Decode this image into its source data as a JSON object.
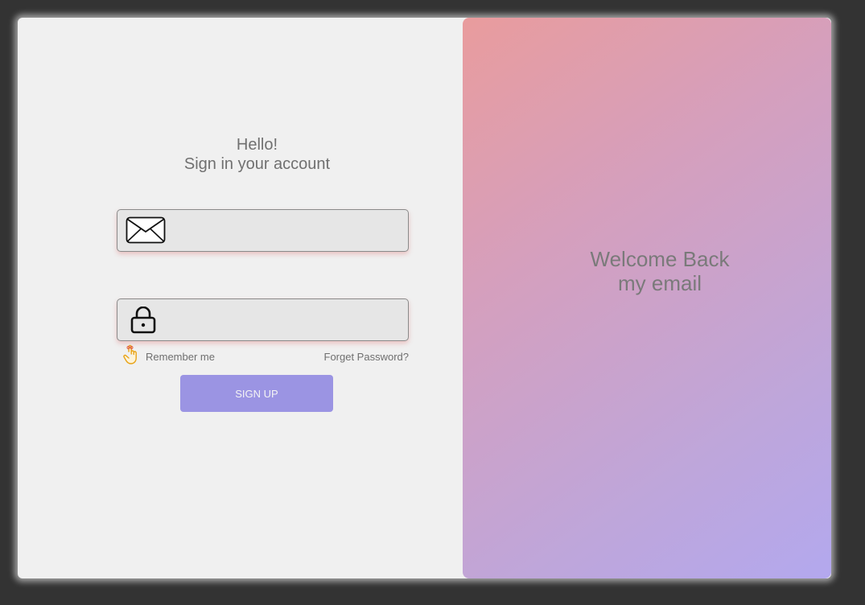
{
  "signin": {
    "greeting_line1": "Hello!",
    "greeting_line2": "Sign in your account",
    "email": {
      "value": "",
      "placeholder": "",
      "icon": "envelope-icon"
    },
    "password": {
      "value": "",
      "placeholder": "",
      "icon": "lock-icon"
    },
    "remember_label": "Remember me",
    "remember_icon": "pointing-hand-icon",
    "forgot_label": "Forget Password?",
    "submit_label": "SIGN UP"
  },
  "welcome": {
    "line1": "Welcome Back",
    "line2": "my email"
  },
  "colors": {
    "page_background": "#333333",
    "card_background": "#f0f0f0",
    "submit_button": "#9b94e3",
    "gradient_start": "#e99c9d",
    "gradient_end": "#b3a8ee",
    "text_muted": "#707070"
  }
}
